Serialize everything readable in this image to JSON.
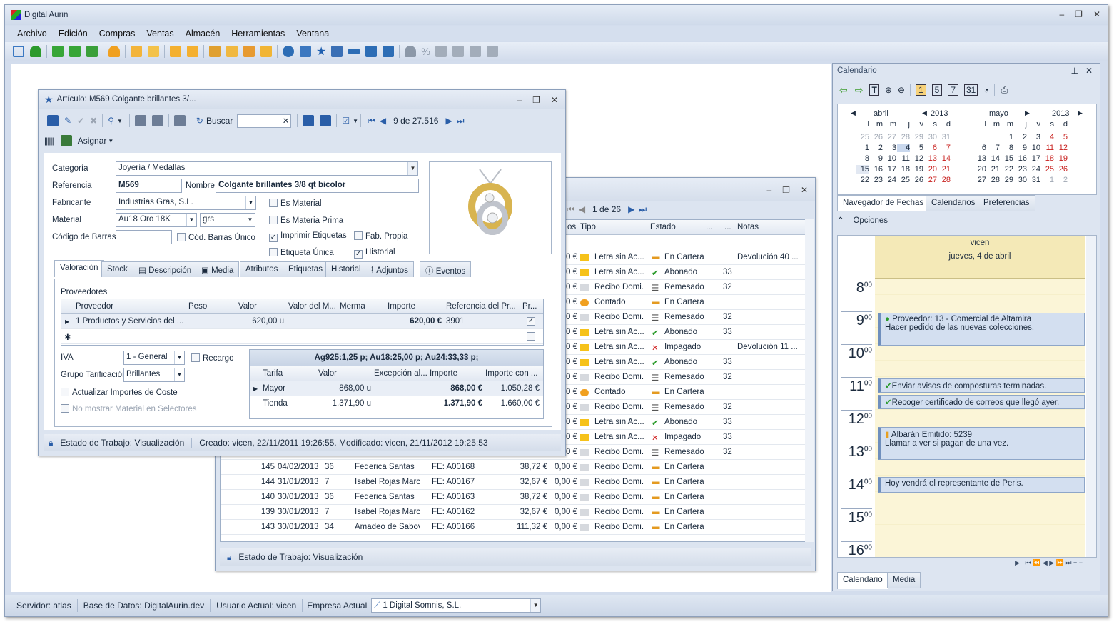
{
  "app": {
    "title": "Digital Aurin"
  },
  "menu": [
    "Archivo",
    "Edición",
    "Compras",
    "Ventas",
    "Almacén",
    "Herramientas",
    "Ventana"
  ],
  "status": {
    "server": "Servidor: atlas",
    "db": "Base de Datos: DigitalAurin.dev",
    "user": "Usuario Actual: vicen",
    "company_label": "Empresa Actual",
    "company": "1  Digital Somnis, S.L."
  },
  "article": {
    "title": "Artículo: M569 Colgante brillantes 3/...",
    "buscar": "Buscar",
    "record": "9 de 27.516",
    "asignar": "Asignar",
    "labels": {
      "categoria": "Categoría",
      "referencia": "Referencia",
      "nombre": "Nombre",
      "fabricante": "Fabricante",
      "material": "Material",
      "codigo": "Código de Barras"
    },
    "values": {
      "categoria": "Joyería / Medallas",
      "referencia": "M569",
      "nombre": "Colgante brillantes 3/8 qt bicolor",
      "fabricante": "Industrias Gras, S.L.",
      "material": "Au18 Oro 18K",
      "unidad": "grs"
    },
    "checks": {
      "cod_unico": "Cód. Barras Único",
      "es_material": "Es Material",
      "es_materia_prima": "Es Materia Prima",
      "imprimir": "Imprimir Etiquetas",
      "fab_propia": "Fab. Propia",
      "etiqueta_unica": "Etiqueta Única",
      "historial": "Historial"
    },
    "tabs": [
      "Valoración",
      "Stock",
      "Descripción",
      "Media",
      "Atributos",
      "Etiquetas",
      "Historial",
      "Adjuntos",
      "Eventos"
    ],
    "proveedores_label": "Proveedores",
    "prov_head": [
      "Proveedor",
      "Peso",
      "Valor",
      "Valor del M...",
      "Merma",
      "Importe",
      "Referencia del Pr...",
      "Pr..."
    ],
    "prov_row": [
      "1  Productos y Servicios del ...",
      "",
      "620,00 u",
      "",
      "",
      "620,00 €",
      "3901"
    ],
    "iva_label": "IVA",
    "iva": "1 - General",
    "recargo": "Recargo",
    "grupo_label": "Grupo Tarificación",
    "grupo": "Brillantes",
    "actualizar": "Actualizar Importes de Coste",
    "no_mostrar": "No mostrar Material en Selectores",
    "tarifa_title": "Ag925:1,25 p;   Au18:25,00 p;   Au24:33,33 p;",
    "tarifa_head": [
      "Tarifa",
      "Valor",
      "Excepción al...",
      "Importe",
      "Importe con ..."
    ],
    "tarifa_rows": [
      [
        "Mayor",
        "868,00 u",
        "",
        "868,00 €",
        "1.050,28 €"
      ],
      [
        "Tienda",
        "1.371,90 u",
        "",
        "1.371,90 €",
        "1.660,00 €"
      ]
    ],
    "estado": "Estado de Trabajo: Visualización",
    "creado": "Creado: vicen, 22/11/2011 19:26:55. Modificado: vicen, 21/11/2012 19:25:53"
  },
  "docs": {
    "record": "1 de 26",
    "head": [
      "os",
      "Tipo",
      "Estado",
      "...",
      "...",
      "Notas"
    ],
    "rows": [
      [
        "",
        "",
        "",
        "",
        "0 €",
        "Letra sin Ac...",
        "yellow",
        "En Cartera",
        "cartera",
        "",
        "Devolución 40 ..."
      ],
      [
        "",
        "",
        "",
        "",
        "0 €",
        "Letra sin Ac...",
        "yellow",
        "Abonado",
        "ok",
        "33",
        ""
      ],
      [
        "",
        "",
        "",
        "",
        "0 €",
        "Recibo Domi...",
        "gray",
        "Remesado",
        "list",
        "32",
        ""
      ],
      [
        "",
        "",
        "",
        "",
        "0 €",
        "Contado",
        "orange",
        "En Cartera",
        "cartera",
        "",
        ""
      ],
      [
        "",
        "",
        "",
        "",
        "0 €",
        "Recibo Domi...",
        "gray",
        "Remesado",
        "list",
        "32",
        ""
      ],
      [
        "",
        "",
        "",
        "",
        "0 €",
        "Letra sin Ac...",
        "yellow",
        "Abonado",
        "ok",
        "33",
        ""
      ],
      [
        "",
        "",
        "",
        "",
        "0 €",
        "Letra sin Ac...",
        "yellow",
        "Impagado",
        "x",
        "",
        "Devolución 11 ..."
      ],
      [
        "",
        "",
        "",
        "",
        "0 €",
        "Letra sin Ac...",
        "yellow",
        "Abonado",
        "ok",
        "33",
        ""
      ],
      [
        "",
        "",
        "",
        "",
        "0 €",
        "Recibo Domi...",
        "gray",
        "Remesado",
        "list",
        "32",
        ""
      ],
      [
        "",
        "",
        "",
        "",
        "0 €",
        "Contado",
        "orange",
        "En Cartera",
        "cartera",
        "",
        ""
      ],
      [
        "",
        "",
        "",
        "",
        "0 €",
        "Recibo Domi...",
        "gray",
        "Remesado",
        "list",
        "32",
        ""
      ],
      [
        "",
        "",
        "",
        "",
        "0 €",
        "Letra sin Ac...",
        "yellow",
        "Abonado",
        "ok",
        "33",
        ""
      ],
      [
        "",
        "",
        "",
        "",
        "0 €",
        "Letra sin Ac...",
        "yellow",
        "Impagado",
        "x",
        "33",
        ""
      ],
      [
        "",
        "",
        "",
        "",
        "0 €",
        "Recibo Domi...",
        "gray",
        "Remesado",
        "list",
        "32",
        ""
      ],
      [
        "145",
        "04/02/2013",
        "36",
        "Federica Santas",
        "FE: A00168",
        "38,72 €",
        "0,00 €",
        "Recibo Domi...",
        "gray",
        "En Cartera",
        "cartera"
      ],
      [
        "144",
        "31/01/2013",
        "7",
        "Isabel Rojas Marcos",
        "FE: A00167",
        "32,67 €",
        "0,00 €",
        "Recibo Domi...",
        "gray",
        "En Cartera",
        "cartera"
      ],
      [
        "140",
        "30/01/2013",
        "36",
        "Federica Santas",
        "FE: A00163",
        "38,72 €",
        "0,00 €",
        "Recibo Domi...",
        "gray",
        "En Cartera",
        "cartera"
      ],
      [
        "139",
        "30/01/2013",
        "7",
        "Isabel Rojas Marcos",
        "FE: A00162",
        "32,67 €",
        "0,00 €",
        "Recibo Domi...",
        "gray",
        "En Cartera",
        "cartera"
      ],
      [
        "143",
        "30/01/2013",
        "34",
        "Amadeo de Sabova",
        "FE: A00166",
        "111,32 €",
        "0,00 €",
        "Recibo Domi...",
        "gray",
        "En Cartera",
        "cartera"
      ]
    ],
    "estado": "Estado de Trabajo: Visualización"
  },
  "calendar": {
    "title": "Calendario",
    "m1": {
      "month": "abril",
      "year": "2013"
    },
    "m2": {
      "month": "mayo",
      "year": "2013"
    },
    "dow": [
      "l",
      "m",
      "m",
      "j",
      "v",
      "s",
      "d"
    ],
    "tabs": [
      "Navegador de Fechas",
      "Calendarios",
      "Preferencias"
    ],
    "opciones": "Opciones",
    "user": "vicen",
    "day": "jueves, 4 de abril",
    "hours": [
      "8",
      "9",
      "10",
      "11",
      "12",
      "13",
      "14",
      "15",
      "16"
    ],
    "appts": [
      {
        "t1": "Proveedor: 13 - Comercial de Altamira",
        "t2": "Hacer pedido de las nuevas colecciones."
      },
      {
        "t1": "Enviar avisos de composturas terminadas."
      },
      {
        "t1": "Recoger certificado de correos que llegó ayer."
      },
      {
        "t1": "Albarán Emitido: 5239",
        "t2": "Llamar a ver si pagan de una vez."
      },
      {
        "t1": "Hoy vendrá el representante de Peris."
      }
    ],
    "bottom_tabs": [
      "Calendario",
      "Media"
    ]
  }
}
